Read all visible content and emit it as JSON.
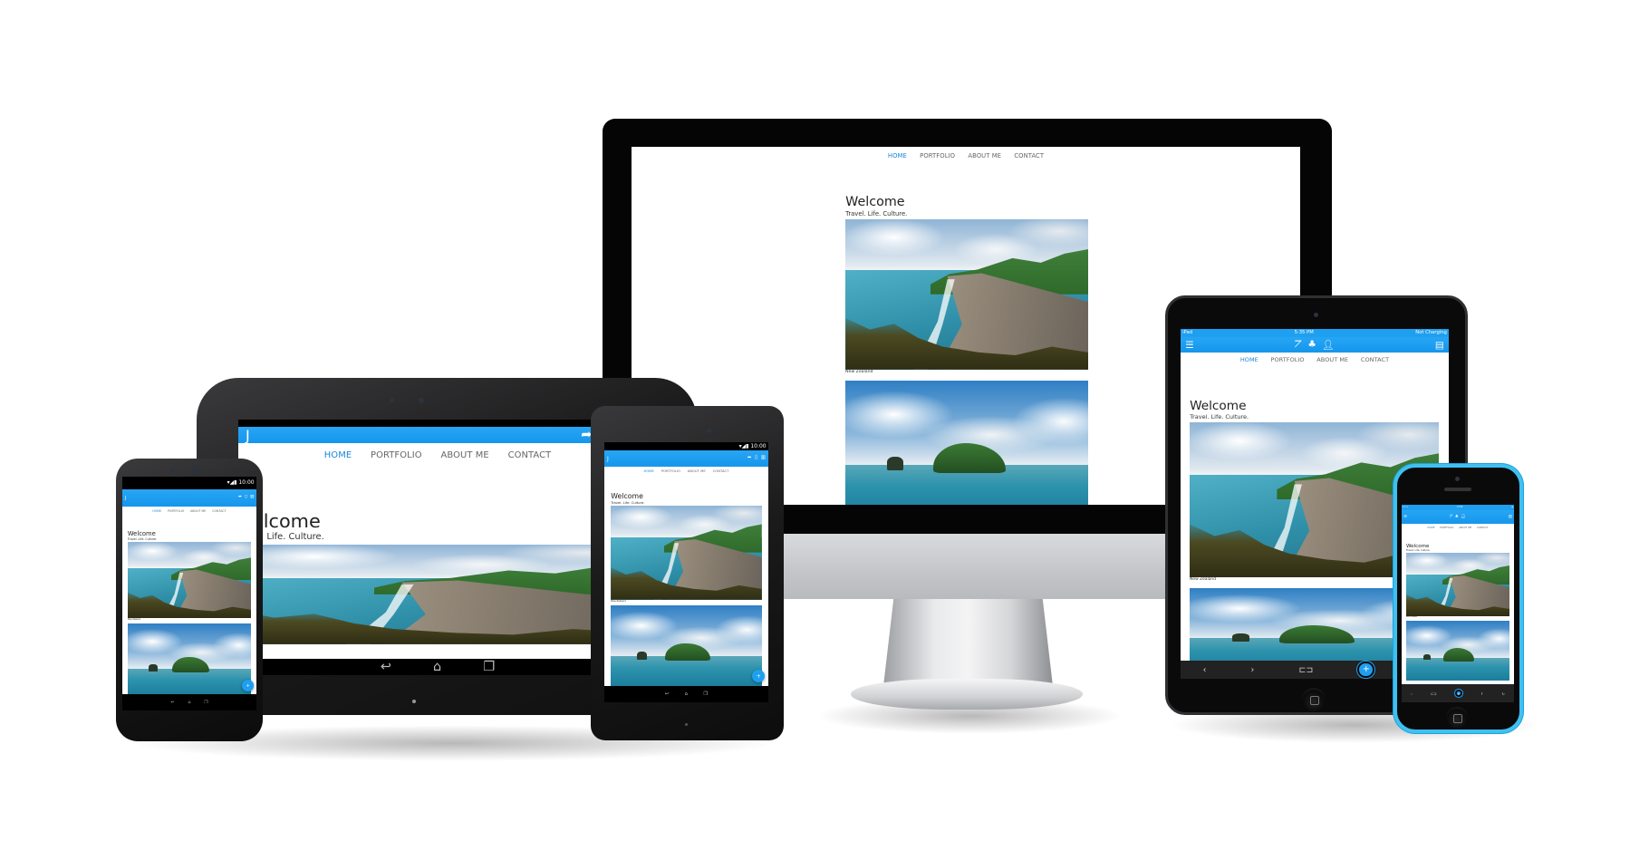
{
  "site": {
    "nav": [
      {
        "label": "HOME",
        "active": true
      },
      {
        "label": "PORTFOLIO"
      },
      {
        "label": "ABOUT ME"
      },
      {
        "label": "CONTACT"
      }
    ],
    "welcome": "Welcome",
    "tagline": "Travel. Life. Culture.",
    "caption": "New Zealand",
    "app_logo": "J"
  },
  "status": {
    "android_time": "10:00",
    "ipad": {
      "left": "iPad",
      "time": "5:35 PM",
      "right": "Not Charging"
    },
    "iphone": {
      "left": "•••••",
      "time": "17:20",
      "right": "▬"
    }
  },
  "icons": {
    "android_appbar": [
      "share-icon",
      "phone-icon",
      "panel-icon"
    ],
    "ios_appbar": [
      "menu-icon",
      "chart-icon",
      "clover-icon",
      "user-icon",
      "panel-icon"
    ],
    "android_navbar": [
      "back-icon",
      "home-icon",
      "recents-icon"
    ],
    "ios_toolbar": [
      "back-icon",
      "forward-icon",
      "laptop-icon",
      "plus-icon",
      "share-icon",
      "refresh-icon"
    ]
  },
  "colors": {
    "accent": "#1e9ff0",
    "nav_active": "#1a86d8",
    "iphone_case": "#3ec0f0"
  },
  "devices": [
    "desktop-monitor",
    "android-tablet-large",
    "android-tablet-small",
    "android-phone",
    "ipad",
    "iphone"
  ]
}
